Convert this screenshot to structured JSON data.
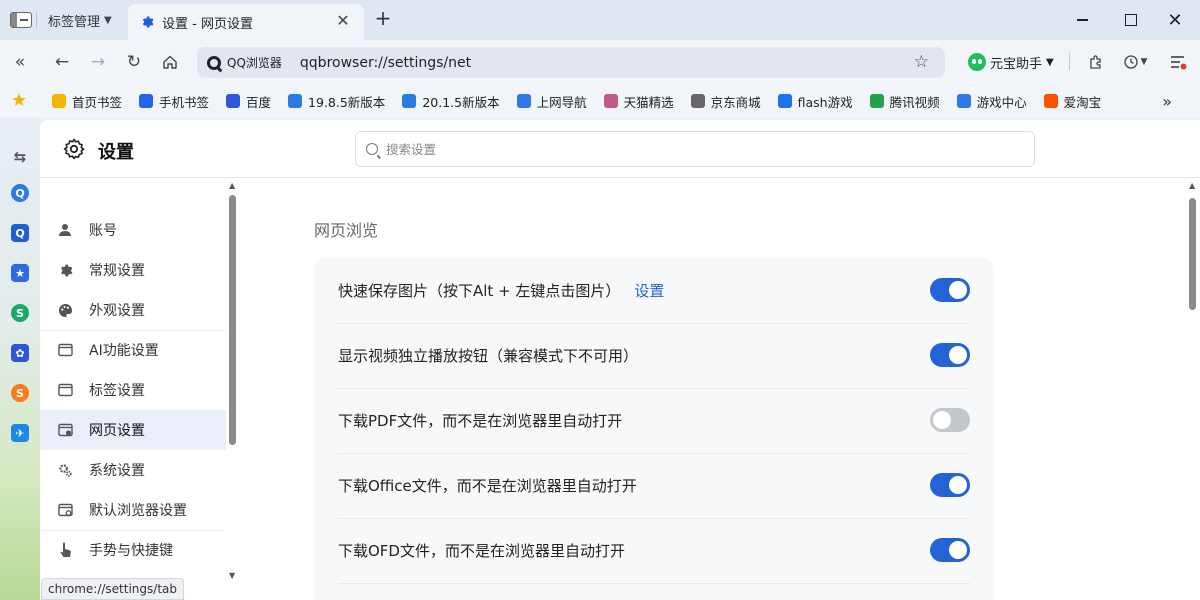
{
  "tabstrip": {
    "group_label": "标签管理",
    "active_tab_title": "设置 - 网页设置",
    "close_glyph": "✕",
    "new_tab_glyph": "+"
  },
  "toolbar": {
    "address_brand": "QQ浏览器",
    "address_url": "qqbrowser://settings/net",
    "assistant_label": "元宝助手"
  },
  "bookmarks": [
    {
      "label": "首页书签",
      "icon": "bookmark-icon",
      "color": "#f5b400"
    },
    {
      "label": "手机书签",
      "icon": "phone-icon",
      "color": "#2563eb"
    },
    {
      "label": "百度",
      "icon": "baidu-icon",
      "color": "#2f56d8"
    },
    {
      "label": "19.8.5新版本",
      "icon": "qq-browser-icon",
      "color": "#2c7be5"
    },
    {
      "label": "20.1.5新版本",
      "icon": "qq-browser-icon",
      "color": "#2c7be5"
    },
    {
      "label": "上网导航",
      "icon": "qq-browser-icon",
      "color": "#2c7be5"
    },
    {
      "label": "天猫精选",
      "icon": "tmall-icon",
      "color": "#c05a8a"
    },
    {
      "label": "京东商城",
      "icon": "jd-icon",
      "color": "#666666"
    },
    {
      "label": "flash游戏",
      "icon": "flash-icon",
      "color": "#1a73e8"
    },
    {
      "label": "腾讯视频",
      "icon": "tencent-video-icon",
      "color": "#22a34a"
    },
    {
      "label": "游戏中心",
      "icon": "qq-browser-icon",
      "color": "#2c7be5"
    },
    {
      "label": "爱淘宝",
      "icon": "taobao-icon",
      "color": "#ff5000"
    }
  ],
  "settings": {
    "title": "设置",
    "search_placeholder": "搜索设置",
    "nav": [
      {
        "label": "账号",
        "icon": "person-icon"
      },
      {
        "label": "常规设置",
        "icon": "gear-icon"
      },
      {
        "label": "外观设置",
        "icon": "palette-icon"
      },
      {
        "label": "AI功能设置",
        "icon": "window-icon"
      },
      {
        "label": "标签设置",
        "icon": "window-icon"
      },
      {
        "label": "网页设置",
        "icon": "webpage-icon",
        "active": true
      },
      {
        "label": "系统设置",
        "icon": "gears-icon"
      },
      {
        "label": "默认浏览器设置",
        "icon": "browser-icon"
      },
      {
        "label": "手势与快捷键",
        "icon": "hand-icon"
      }
    ],
    "section_title": "网页浏览",
    "rows": [
      {
        "label": "快速保存图片（按下Alt + 左键点击图片）",
        "link": "设置",
        "enabled": true
      },
      {
        "label": "显示视频独立播放按钮（兼容模式下不可用）",
        "enabled": true
      },
      {
        "label": "下载PDF文件，而不是在浏览器里自动打开",
        "enabled": false
      },
      {
        "label": "下载Office文件，而不是在浏览器里自动打开",
        "enabled": true
      },
      {
        "label": "下载OFD文件，而不是在浏览器里自动打开",
        "enabled": true
      }
    ]
  },
  "statusbar": {
    "text": "chrome://settings/tab"
  },
  "colors": {
    "accent": "#2463d6",
    "toggle_off": "#c4c7cc",
    "active_nav_bg": "#e9eef9"
  }
}
